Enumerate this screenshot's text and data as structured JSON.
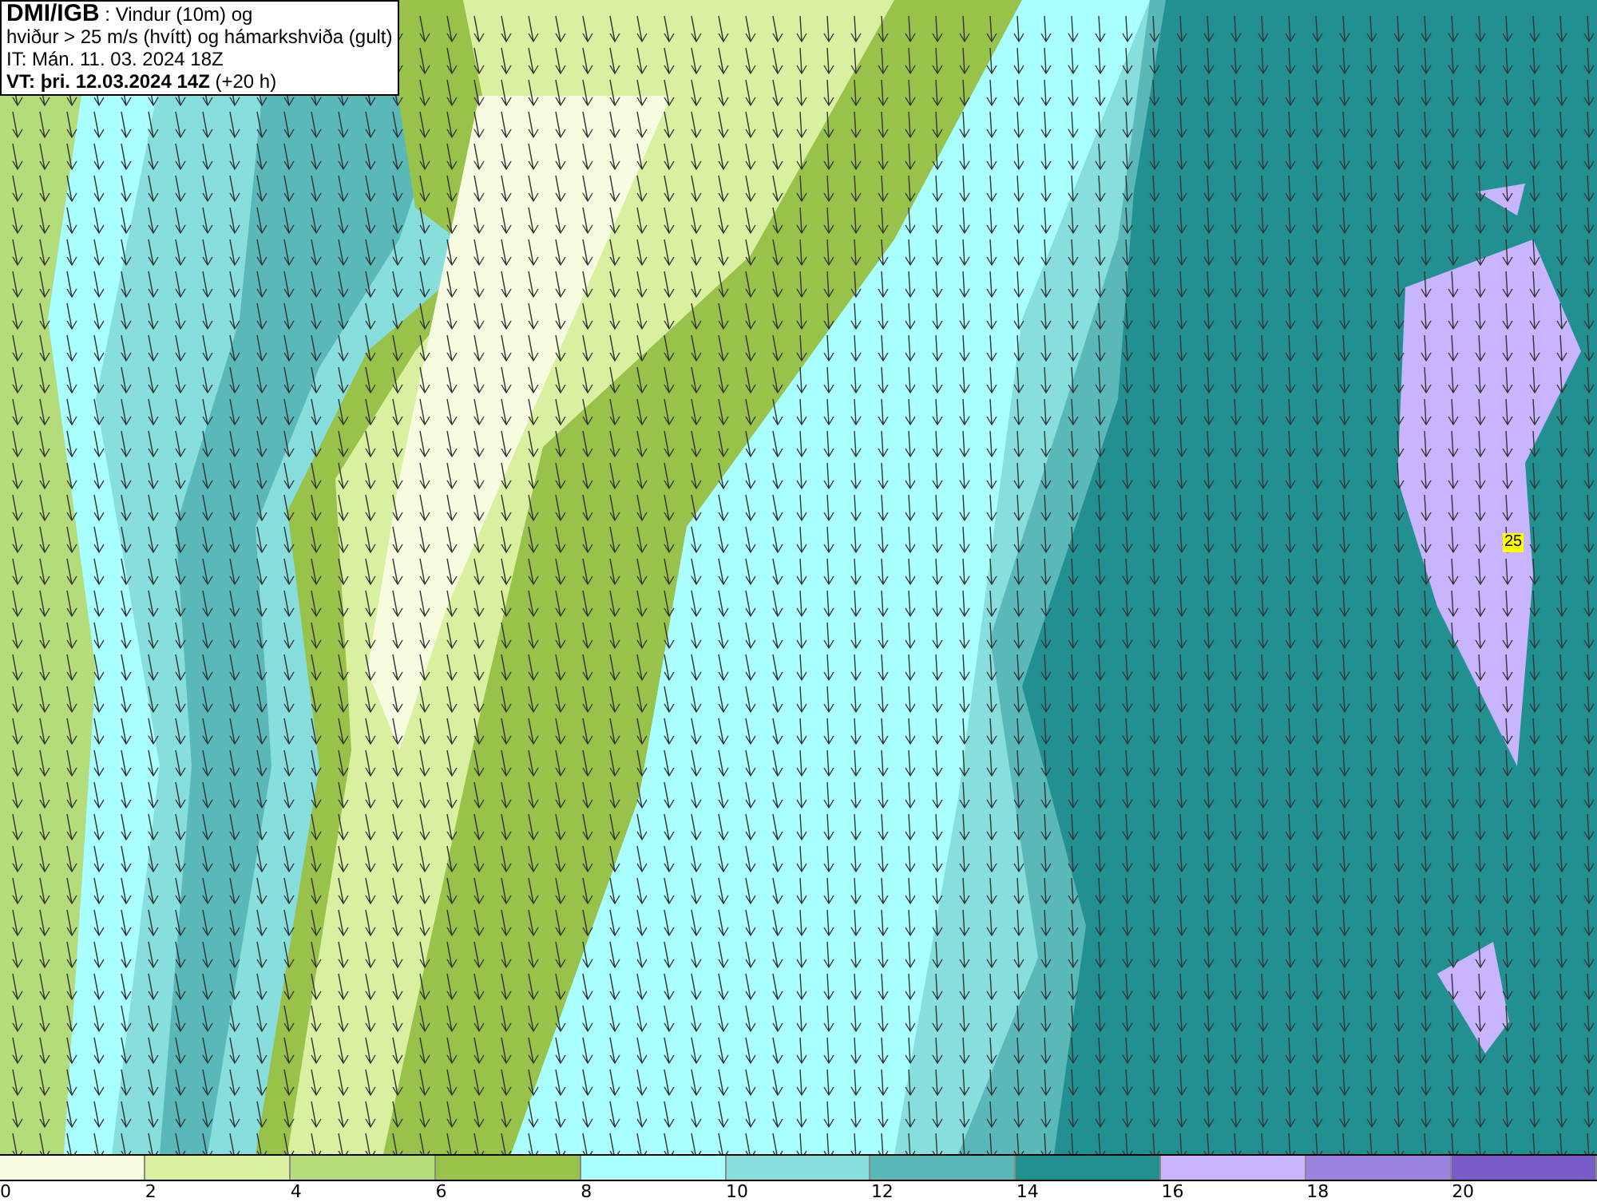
{
  "header": {
    "lines": [
      "**DMI/IGB** : Vindur (10m) og",
      "hviður > 25 m/s (hvítt) og hámarkshviða (gult)",
      "IT: Mán. 11. 03. 2024 18Z",
      "**VT: þri. 12.03.2024 14Z** (+20 h)"
    ]
  },
  "map": {
    "gust_marker": "25"
  },
  "legend": [
    {
      "label": "0",
      "color": "#f7fbe0"
    },
    {
      "label": "2",
      "color": "#d9f0a0"
    },
    {
      "label": "4",
      "color": "#b5dc7a"
    },
    {
      "label": "6",
      "color": "#99c24a"
    },
    {
      "label": "8",
      "color": "#aaffff"
    },
    {
      "label": "10",
      "color": "#88dddd"
    },
    {
      "label": "12",
      "color": "#5ab8b8"
    },
    {
      "label": "14",
      "color": "#229090"
    },
    {
      "label": "16",
      "color": "#c8b4ff"
    },
    {
      "label": "18",
      "color": "#9a84e0"
    },
    {
      "label": "20",
      "color": "#7a5cc8"
    }
  ]
}
